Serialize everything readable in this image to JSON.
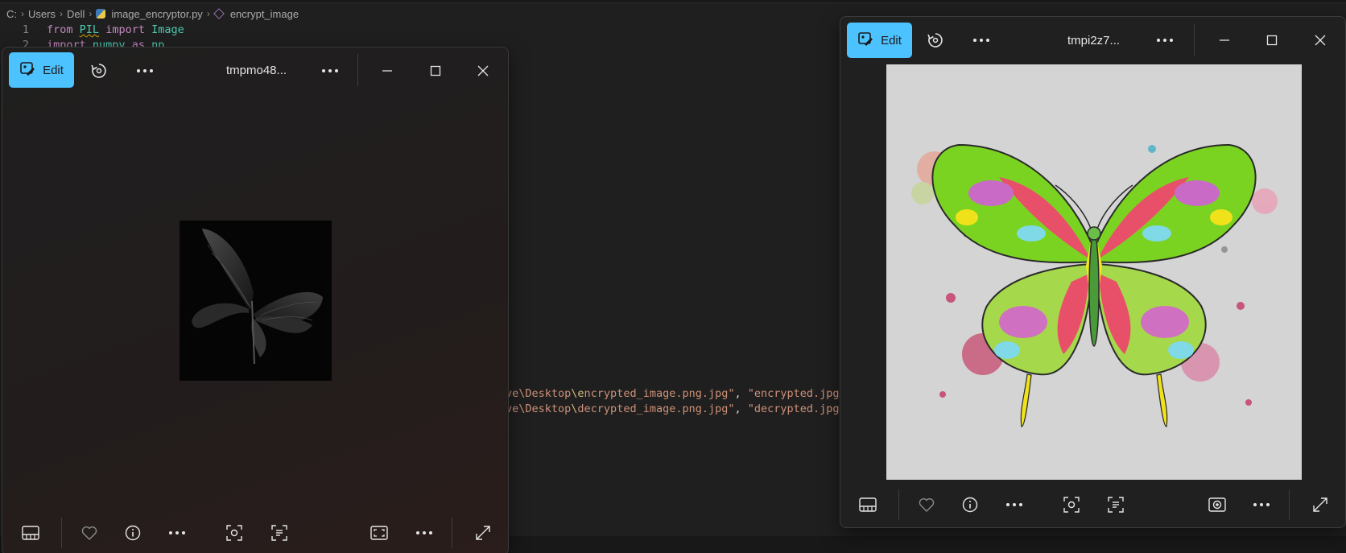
{
  "editor": {
    "breadcrumb": {
      "drive": "C:",
      "folder1": "Users",
      "folder2": "Dell",
      "file": "image_encryptor.py",
      "symbol": "encrypt_image"
    },
    "lines": [
      {
        "num": "1",
        "kw1": "from",
        "mod": "PIL",
        "kw2": "import",
        "name": "Image"
      },
      {
        "num": "2",
        "kw1": "import",
        "mod": "numpy",
        "kw2": "as",
        "name": "np"
      }
    ],
    "string_lines": [
      {
        "path_a": "ve\\Desktop",
        "esc": "\\e",
        "path_b": "ncrypted_image.png.jpg\"",
        "sep": ", ",
        "out": "\"encrypted.jpg\""
      },
      {
        "path_a": "ve\\Desktop",
        "esc": "\\",
        "path_b": "decrypted_image.png.jpg\"",
        "sep": ", ",
        "out": "\"decrypted.jpg\""
      }
    ]
  },
  "viewer_left": {
    "edit_label": "Edit",
    "title": "tmpmo48...",
    "icons": [
      "edit-icon",
      "rotate-icon",
      "more-icon",
      "minimize-icon",
      "maximize-icon",
      "close-icon",
      "filmstrip-icon",
      "favorite-icon",
      "info-icon",
      "visual-search-icon",
      "text-recognize-icon",
      "fit-icon",
      "fullscreen-icon"
    ]
  },
  "viewer_right": {
    "edit_label": "Edit",
    "title": "tmpi2z7...",
    "icons": [
      "edit-icon",
      "rotate-icon",
      "more-icon",
      "minimize-icon",
      "maximize-icon",
      "close-icon",
      "filmstrip-icon",
      "favorite-icon",
      "info-icon",
      "visual-search-icon",
      "text-recognize-icon",
      "bokeh-icon",
      "fullscreen-icon"
    ]
  },
  "colors": {
    "accent": "#4cc2ff",
    "editor_bg": "#1f1f1f",
    "viewer_bg": "#202020",
    "photo_bg_right": "#d4d4d4"
  }
}
